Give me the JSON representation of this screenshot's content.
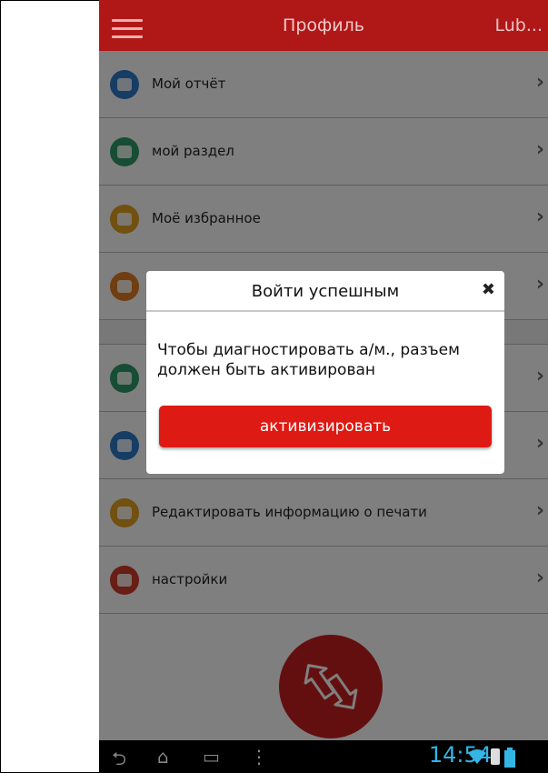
{
  "header": {
    "title": "Профиль",
    "user": "Lub..."
  },
  "menu": [
    {
      "label": "Мой отчёт",
      "icon": "report-chart-icon",
      "color": "#2f7ac8"
    },
    {
      "label": "мой раздел",
      "icon": "share-section-icon",
      "color": "#2f9a6b"
    },
    {
      "label": "Моё избранное",
      "icon": "favorites-folder-icon",
      "color": "#e3a021"
    },
    {
      "label": "",
      "icon": "globe-icon",
      "color": "#e07d22"
    },
    {
      "label": "",
      "icon": "gauge-icon",
      "color": "#2f9a6b"
    },
    {
      "label": "",
      "icon": "id-card-icon",
      "color": "#2f7ac8"
    },
    {
      "label": "Редактировать информацию о печати",
      "icon": "printer-icon",
      "color": "#e3a021"
    },
    {
      "label": "настройки",
      "icon": "settings-gear-icon",
      "color": "#d03a2a"
    }
  ],
  "dialog": {
    "title": "Войти успешным",
    "message": "Чтобы диагностировать а/м., разъем должен быть активирован",
    "button": "активизировать"
  },
  "status": {
    "time": "14:54"
  },
  "colors": {
    "accent": "#b01818",
    "button": "#dd1a14",
    "clock": "#33b5e5"
  }
}
